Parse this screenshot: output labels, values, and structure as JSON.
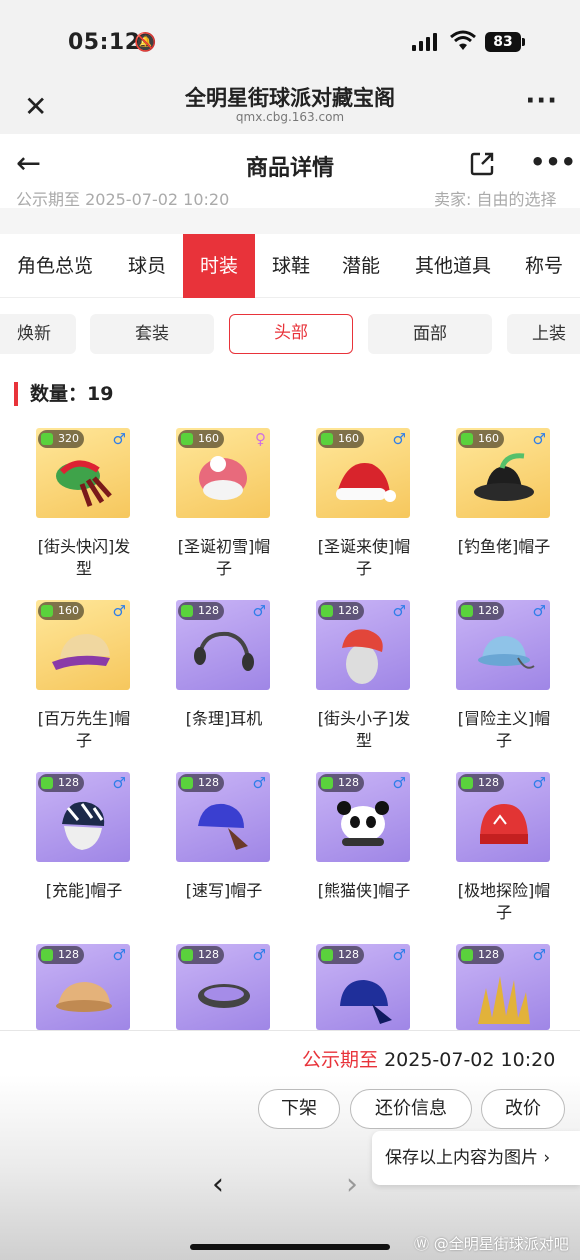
{
  "status_bar": {
    "time": "05:12",
    "battery": "83"
  },
  "browser": {
    "title": "全明星街球派对藏宝阁",
    "url": "qmx.cbg.163.com"
  },
  "header": {
    "title": "商品详情"
  },
  "peek": {
    "left": "公示期至 2025-07-02 10:20",
    "right": "卖家: 自由的选择"
  },
  "tabs": [
    "角色总览",
    "球员",
    "时装",
    "球鞋",
    "潜能",
    "其他道具",
    "称号"
  ],
  "active_tab": "时装",
  "subtabs": [
    "焕新",
    "套装",
    "头部",
    "面部",
    "上装"
  ],
  "active_subtab": "头部",
  "count": {
    "label": "数量：",
    "value": "19"
  },
  "items": [
    {
      "name": "[街头快闪]发型",
      "level": "320",
      "gender": "♂",
      "rarity": "gold",
      "icon": "dreadlock-hair-icon"
    },
    {
      "name": "[圣诞初雪]帽子",
      "level": "160",
      "gender": "♀",
      "rarity": "gold",
      "icon": "snow-beanie-icon"
    },
    {
      "name": "[圣诞来使]帽子",
      "level": "160",
      "gender": "♂",
      "rarity": "gold",
      "icon": "santa-hat-icon"
    },
    {
      "name": "[钓鱼佬]帽子",
      "level": "160",
      "gender": "♂",
      "rarity": "gold",
      "icon": "bucket-hat-icon"
    },
    {
      "name": "[百万先生]帽子",
      "level": "160",
      "gender": "♂",
      "rarity": "gold",
      "icon": "cap-icon"
    },
    {
      "name": "[条理]耳机",
      "level": "128",
      "gender": "♂",
      "rarity": "purple",
      "icon": "headset-icon"
    },
    {
      "name": "[街头小子]发型",
      "level": "128",
      "gender": "♂",
      "rarity": "purple",
      "icon": "red-hair-icon"
    },
    {
      "name": "[冒险主义]帽子",
      "level": "128",
      "gender": "♂",
      "rarity": "purple",
      "icon": "blue-cap-icon"
    },
    {
      "name": "[充能]帽子",
      "level": "128",
      "gender": "♂",
      "rarity": "purple",
      "icon": "headwrap-icon"
    },
    {
      "name": "[速写]帽子",
      "level": "128",
      "gender": "♂",
      "rarity": "purple",
      "icon": "bandana-icon"
    },
    {
      "name": "[熊猫侠]帽子",
      "level": "128",
      "gender": "♂",
      "rarity": "purple",
      "icon": "panda-hat-icon"
    },
    {
      "name": "[极地探险]帽子",
      "level": "128",
      "gender": "♂",
      "rarity": "purple",
      "icon": "knit-beanie-icon"
    },
    {
      "name": "",
      "level": "128",
      "gender": "♂",
      "rarity": "purple",
      "icon": "flat-cap-icon"
    },
    {
      "name": "",
      "level": "128",
      "gender": "♂",
      "rarity": "purple",
      "icon": "headband-icon"
    },
    {
      "name": "",
      "level": "128",
      "gender": "♂",
      "rarity": "purple",
      "icon": "du-rag-icon"
    },
    {
      "name": "",
      "level": "128",
      "gender": "♂",
      "rarity": "purple",
      "icon": "spike-hair-icon"
    }
  ],
  "bottom": {
    "publicity_label": "公示期至",
    "publicity_value": "2025-07-02 10:20",
    "buttons": [
      "下架",
      "还价信息",
      "改价"
    ],
    "toast": "保存以上内容为图片 ›",
    "watermark": "Ⓦ @全明星街球派对吧"
  },
  "colors": {
    "accent": "#e8333a",
    "gold_card": "#f6c75d",
    "purple_card": "#a58ce8"
  }
}
